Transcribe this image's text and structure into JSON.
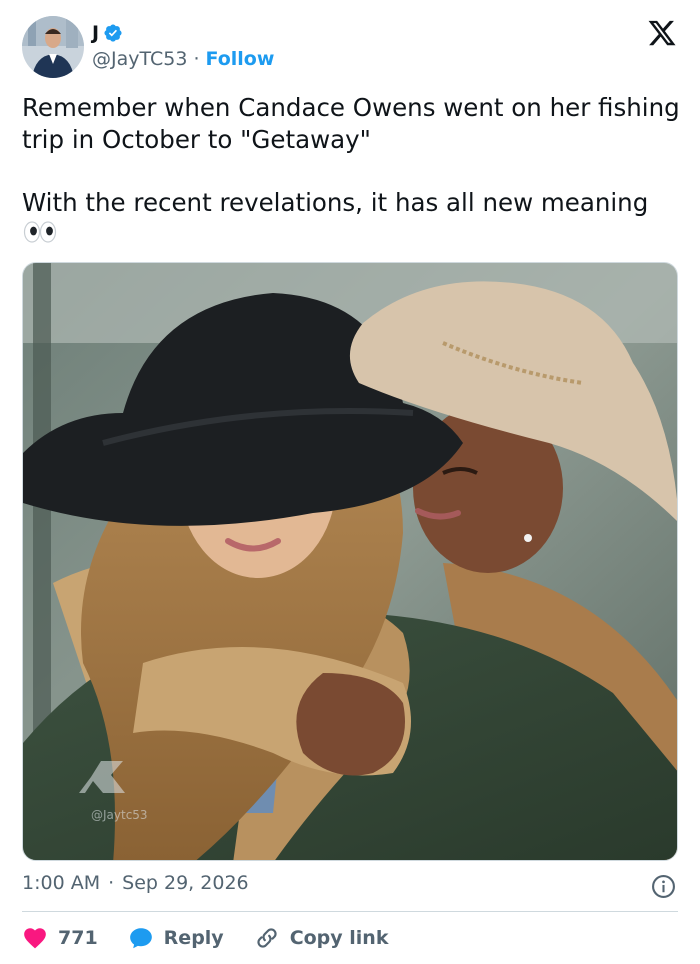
{
  "author": {
    "name": "J",
    "handle": "@JayTC53",
    "separator": "·",
    "follow_label": "Follow",
    "verified": true,
    "verified_color": "#1d9bf0"
  },
  "tweet": {
    "text": "Remember when Candace Owens went on her fishing trip in October to \"Getaway\"\n\nWith the recent revelations, it has all new meaning",
    "emoji_name": "eyes-emoji"
  },
  "media": {
    "watermark": "@Jaytc53"
  },
  "meta": {
    "time": "1:00 AM",
    "separator": "·",
    "date": "Sep 29, 2026"
  },
  "actions": {
    "like_count": "771",
    "reply_label": "Reply",
    "copy_link_label": "Copy link"
  },
  "colors": {
    "accent": "#1d9bf0",
    "like": "#f91880",
    "text": "#0f1419",
    "muted": "#536471"
  }
}
